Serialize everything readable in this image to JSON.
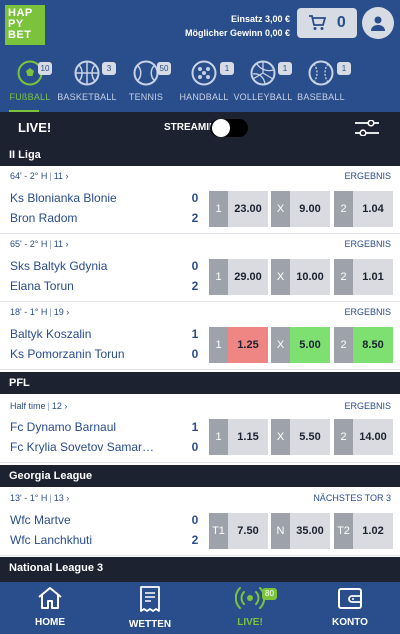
{
  "header": {
    "logo_lines": [
      "HAP",
      "PY",
      "BET"
    ],
    "stake": "Einsatz 3,00 €",
    "potential_win": "Möglicher Gewinn 0,00 €",
    "cart_count": "0"
  },
  "sports": [
    {
      "label": "FUßBALL",
      "count": "10",
      "icon": "soccer-ball-icon",
      "active": true
    },
    {
      "label": "BASKETBALL",
      "count": "3",
      "icon": "basketball-icon"
    },
    {
      "label": "TENNIS",
      "count": "50",
      "icon": "tennis-ball-icon"
    },
    {
      "label": "HANDBALL",
      "count": "1",
      "icon": "handball-icon"
    },
    {
      "label": "VOLLEYBALL",
      "count": "1",
      "icon": "volleyball-icon"
    },
    {
      "label": "BASEBALL",
      "count": "1",
      "icon": "baseball-icon"
    }
  ],
  "livebar": {
    "live": "LIVE!",
    "streaming": "STREAMING"
  },
  "leagues": {
    "l1": "II Liga",
    "l2": "PFL",
    "l3": "Georgia League",
    "l4": "National League 3"
  },
  "matches": {
    "m1": {
      "time": "64' - 2° H",
      "id": "11",
      "market": "ERGEBNIS",
      "home": "Ks Blonianka Blonie",
      "away": "Bron Radom",
      "home_score": "0",
      "away_score": "2",
      "o1_lbl": "1",
      "o1": "23.00",
      "o2_lbl": "X",
      "o2": "9.00",
      "o3_lbl": "2",
      "o3": "1.04"
    },
    "m2": {
      "time": "65' - 2° H",
      "id": "11",
      "market": "ERGEBNIS",
      "home": "Sks Baltyk Gdynia",
      "away": "Elana Torun",
      "home_score": "0",
      "away_score": "2",
      "o1_lbl": "1",
      "o1": "29.00",
      "o2_lbl": "X",
      "o2": "10.00",
      "o3_lbl": "2",
      "o3": "1.01"
    },
    "m3": {
      "time": "18' - 1° H",
      "id": "19",
      "market": "ERGEBNIS",
      "home": "Baltyk Koszalin",
      "away": "Ks Pomorzanin Torun",
      "home_score": "1",
      "away_score": "0",
      "o1_lbl": "1",
      "o1": "1.25",
      "o2_lbl": "X",
      "o2": "5.00",
      "o3_lbl": "2",
      "o3": "8.50"
    },
    "m4": {
      "time": "Half time",
      "id": "12",
      "market": "ERGEBNIS",
      "home": "Fc Dynamo Barnaul",
      "away": "Fc Krylia Sovetov Samar…",
      "home_score": "1",
      "away_score": "0",
      "o1_lbl": "1",
      "o1": "1.15",
      "o2_lbl": "X",
      "o2": "5.50",
      "o3_lbl": "2",
      "o3": "14.00"
    },
    "m5": {
      "time": "13' - 1° H",
      "id": "13",
      "market": "NÄCHSTES TOR 3",
      "home": "Wfc Martve",
      "away": "Wfc Lanchkhuti",
      "home_score": "0",
      "away_score": "2",
      "o1_lbl": "T1",
      "o1": "7.50",
      "o2_lbl": "N",
      "o2": "35.00",
      "o3_lbl": "T2",
      "o3": "1.02"
    }
  },
  "nav": {
    "home": "HOME",
    "wetten": "WETTEN",
    "live": "LIVE!",
    "live_count": "80",
    "konto": "KONTO"
  },
  "colors": {
    "primary": "#2a4d8c",
    "accent": "#7cc33c",
    "dark": "#1c2230",
    "odd_down": "#ef8683",
    "odd_up": "#7de070"
  }
}
